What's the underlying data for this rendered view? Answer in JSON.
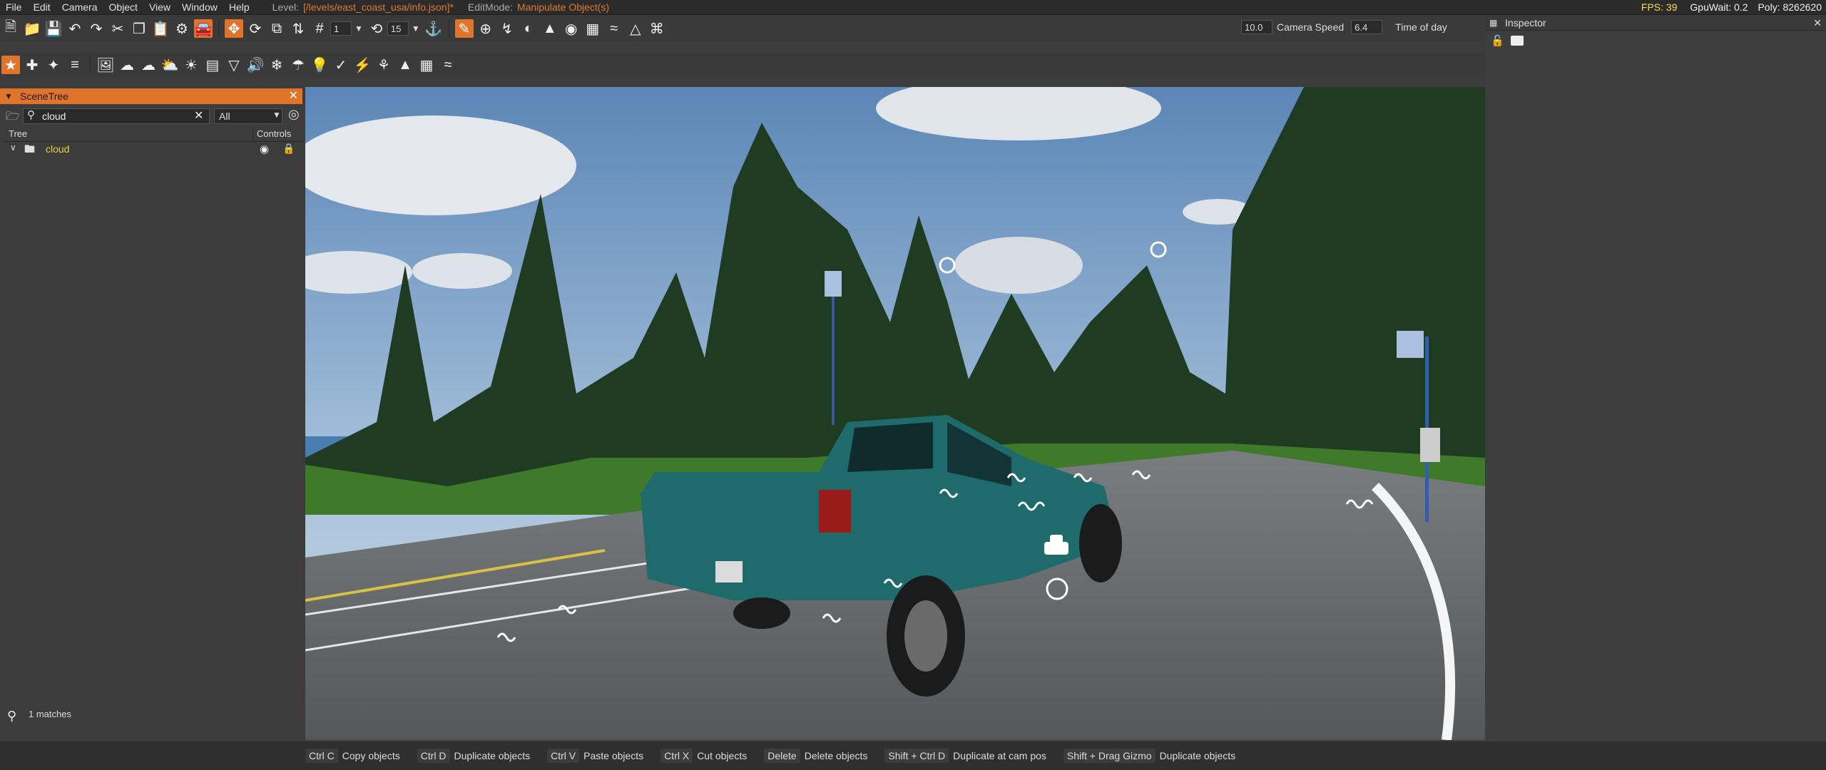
{
  "menu": {
    "items": [
      "File",
      "Edit",
      "Camera",
      "Object",
      "View",
      "Window",
      "Help"
    ],
    "level_label": "Level:",
    "level_value": "[/levels/east_coast_usa/info.json]*",
    "editmode_label": "EditMode:",
    "editmode_value": "Manipulate Object(s)"
  },
  "stats": {
    "fps": "FPS: 39",
    "gpuwait": "GpuWait: 0.2",
    "poly": "Poly: 8262620"
  },
  "toolbar": {
    "snap_value": "1",
    "rotate_snap_value": "15",
    "camera_speed_value": "10.0",
    "camera_speed_label": "Camera Speed",
    "time_value": "6.4",
    "time_label": "Time of day"
  },
  "scenetree": {
    "title": "SceneTree",
    "search_value": "cloud",
    "filter_value": "All",
    "col_tree": "Tree",
    "col_controls": "Controls",
    "item_label": "cloud",
    "matches": "1 matches"
  },
  "inspector": {
    "title": "Inspector"
  },
  "shortcuts": [
    {
      "key": "Ctrl C",
      "desc": "Copy objects"
    },
    {
      "key": "Ctrl D",
      "desc": "Duplicate objects"
    },
    {
      "key": "Ctrl V",
      "desc": "Paste objects"
    },
    {
      "key": "Ctrl X",
      "desc": "Cut objects"
    },
    {
      "key": "Delete",
      "desc": "Delete objects"
    },
    {
      "key": "Shift + Ctrl D",
      "desc": "Duplicate at cam pos"
    },
    {
      "key": "Shift + Drag Gizmo",
      "desc": "Duplicate objects"
    }
  ],
  "colors": {
    "accent": "#e0742b",
    "tree_highlight": "#e8d23c",
    "fps": "#ffd84a"
  }
}
